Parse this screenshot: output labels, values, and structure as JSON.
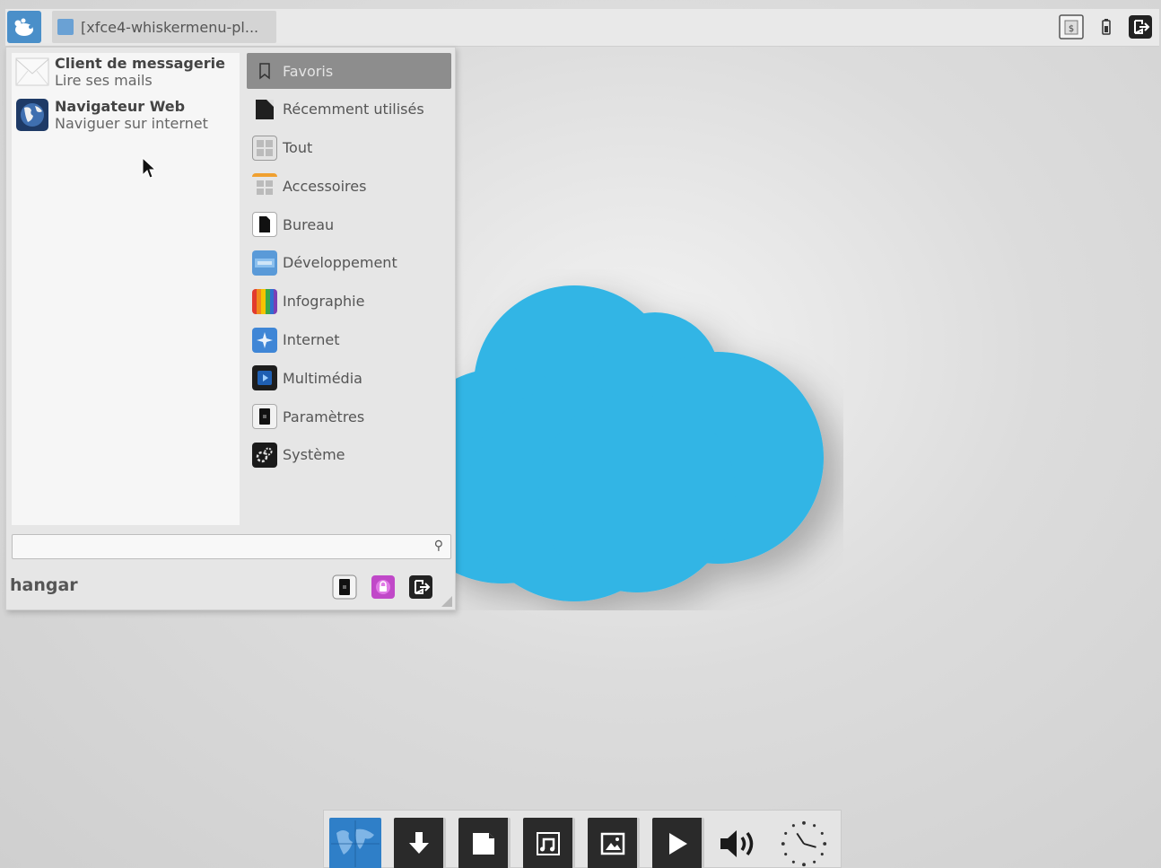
{
  "panel": {
    "window_button_label": "[xfce4-whiskermenu-pl...",
    "menu_icon": "xfce-mouse-icon",
    "tray_icons": [
      "workspace-switcher-icon",
      "battery-icon",
      "logout-icon"
    ]
  },
  "menu": {
    "favorites": [
      {
        "name": "Client de messagerie",
        "description": "Lire ses mails",
        "icon": "mail-icon"
      },
      {
        "name": "Navigateur Web",
        "description": "Naviguer sur internet",
        "icon": "web-browser-icon"
      }
    ],
    "categories": [
      {
        "label": "Favoris",
        "icon": "bookmark-icon",
        "active": true
      },
      {
        "label": "Récemment utilisés",
        "icon": "recent-icon"
      },
      {
        "label": "Tout",
        "icon": "all-apps-icon"
      },
      {
        "label": "Accessoires",
        "icon": "accessories-icon"
      },
      {
        "label": "Bureau",
        "icon": "office-icon"
      },
      {
        "label": "Développement",
        "icon": "development-icon"
      },
      {
        "label": "Infographie",
        "icon": "graphics-icon"
      },
      {
        "label": "Internet",
        "icon": "internet-icon"
      },
      {
        "label": "Multimédia",
        "icon": "multimedia-icon"
      },
      {
        "label": "Paramètres",
        "icon": "settings-icon"
      },
      {
        "label": "Système",
        "icon": "system-icon"
      }
    ],
    "search_value": "",
    "username": "hangar",
    "bottom_buttons": [
      "settings-icon",
      "lock-screen-icon",
      "logout-icon"
    ]
  },
  "dock": {
    "items": [
      "world-map-icon",
      "downloads-icon",
      "documents-icon",
      "music-icon",
      "pictures-icon",
      "video-play-icon",
      "volume-icon",
      "clock-icon"
    ]
  },
  "colors": {
    "accent": "#4a8fc9",
    "cloud": "#33b5e5",
    "active_category": "#8d8d8d"
  }
}
